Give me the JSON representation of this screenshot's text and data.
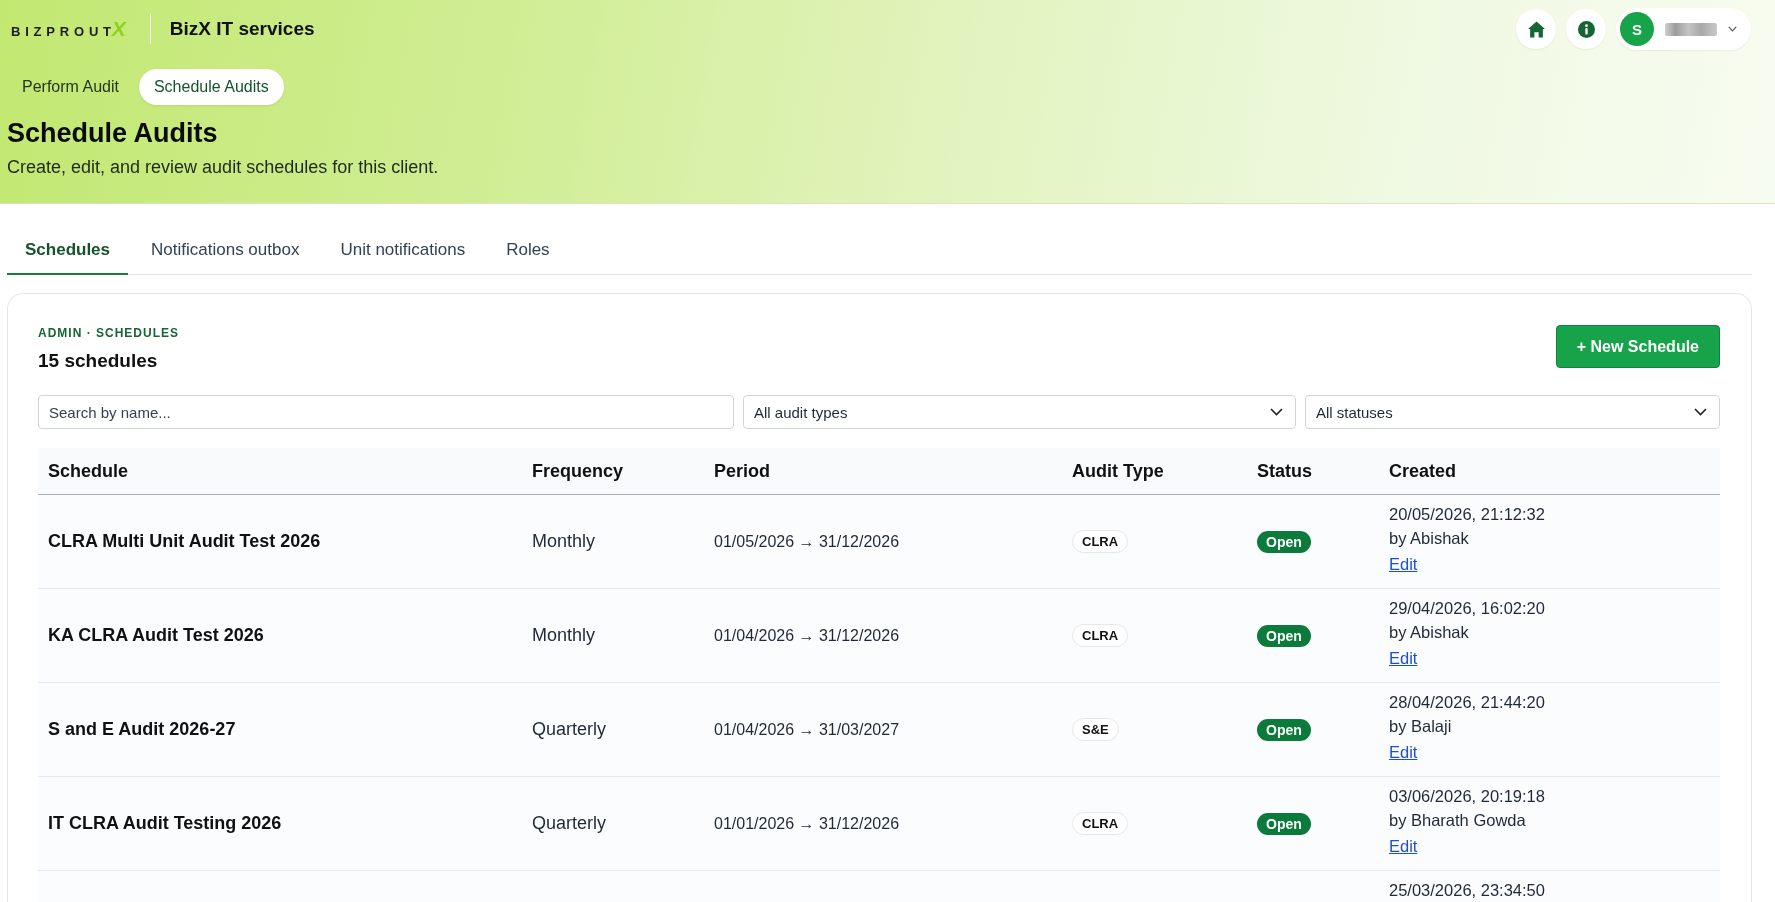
{
  "header": {
    "logo": {
      "text": "BIZPROUT",
      "accent": "X"
    },
    "client_name": "BizX IT services",
    "user": {
      "initial": "S"
    }
  },
  "nav": [
    {
      "label": "Perform Audit",
      "selected": false
    },
    {
      "label": "Schedule Audits",
      "selected": true
    }
  ],
  "page": {
    "title": "Schedule Audits",
    "subtitle": "Create, edit, and review audit schedules for this client."
  },
  "tabs": [
    {
      "label": "Schedules",
      "selected": true
    },
    {
      "label": "Notifications outbox",
      "selected": false
    },
    {
      "label": "Unit notifications",
      "selected": false
    },
    {
      "label": "Roles",
      "selected": false
    }
  ],
  "panel": {
    "eyebrow": "ADMIN · SCHEDULES",
    "count": "15 schedules",
    "new_button": "+ New Schedule",
    "search": {
      "placeholder": "Search by name..."
    },
    "filters": [
      {
        "value": "All audit types"
      },
      {
        "value": "All statuses"
      }
    ]
  },
  "table": {
    "columns": [
      "Schedule",
      "Frequency",
      "Period",
      "Audit Type",
      "Status",
      "Created"
    ],
    "rows": [
      {
        "schedule": "CLRA Multi Unit Audit Test 2026",
        "frequency": "Monthly",
        "period": "01/05/2026 → 31/12/2026",
        "audit_type": "CLRA",
        "status": "Open",
        "created": "20/05/2026, 21:12:32",
        "created_by": "by Abishak",
        "action": "Edit"
      },
      {
        "schedule": "KA CLRA Audit Test 2026",
        "frequency": "Monthly",
        "period": "01/04/2026 → 31/12/2026",
        "audit_type": "CLRA",
        "status": "Open",
        "created": "29/04/2026, 16:02:20",
        "created_by": "by Abishak",
        "action": "Edit"
      },
      {
        "schedule": "S and E Audit 2026-27",
        "frequency": "Quarterly",
        "period": "01/04/2026 → 31/03/2027",
        "audit_type": "S&E",
        "status": "Open",
        "created": "28/04/2026, 21:44:20",
        "created_by": "by Balaji",
        "action": "Edit"
      },
      {
        "schedule": "IT CLRA Audit Testing 2026",
        "frequency": "Quarterly",
        "period": "01/01/2026 → 31/12/2026",
        "audit_type": "CLRA",
        "status": "Open",
        "created": "03/06/2026, 20:19:18",
        "created_by": "by Bharath Gowda",
        "action": "Edit"
      },
      {
        "created": "25/03/2026, 23:34:50"
      }
    ]
  }
}
